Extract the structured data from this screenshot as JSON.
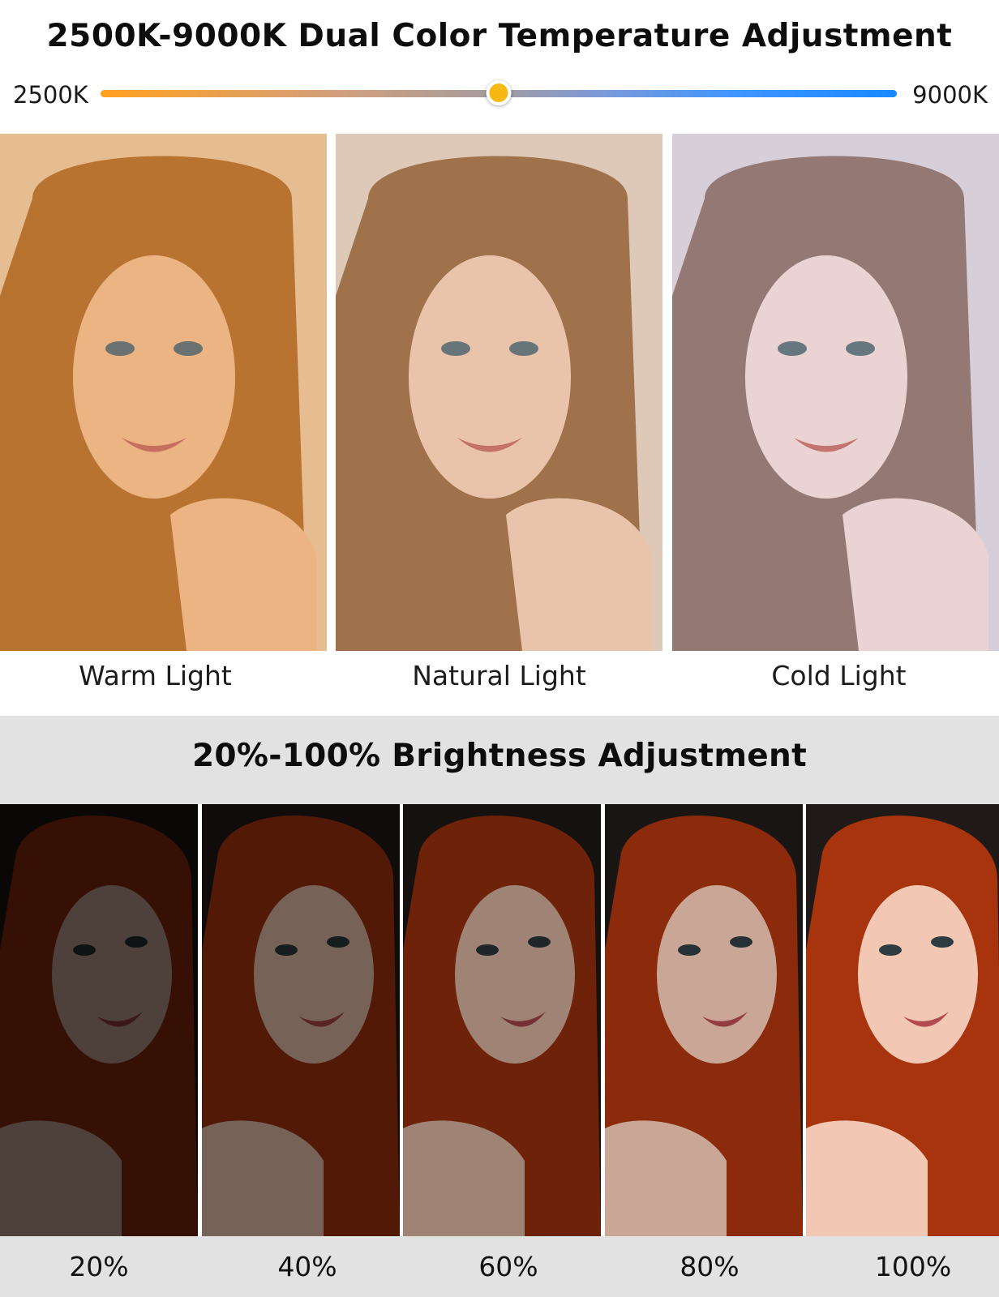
{
  "color_temperature": {
    "title": "2500K-9000K Dual Color Temperature Adjustment",
    "slider": {
      "min_label": "2500K",
      "max_label": "9000K",
      "value_fraction": 0.5
    },
    "gradient_colors": [
      "#ffa01e",
      "#a89c9a",
      "#1888ff"
    ],
    "panels": [
      {
        "label": "Warm Light",
        "tint": "#d98a3e",
        "bg": "#e9c39c",
        "skin": "#f0b98c",
        "hair": "#b5702e"
      },
      {
        "label": "Natural Light",
        "tint": "#c8a487",
        "bg": "#e2cdbf",
        "skin": "#f0c9b0",
        "hair": "#9a6c45"
      },
      {
        "label": "Cold Light",
        "tint": "#c3b6bf",
        "bg": "#d9d2dc",
        "skin": "#f1d8d6",
        "hair": "#8d7069"
      }
    ]
  },
  "brightness": {
    "title": "20%-100% Brightness Adjustment",
    "levels": [
      {
        "label": "20%",
        "level": 0.2
      },
      {
        "label": "40%",
        "level": 0.4
      },
      {
        "label": "60%",
        "level": 0.6
      },
      {
        "label": "80%",
        "level": 0.8
      },
      {
        "label": "100%",
        "level": 1.0
      }
    ],
    "hair_color": "#a8340e",
    "skin_color": "#f2c8b4",
    "background_color": "#1f1a18"
  }
}
